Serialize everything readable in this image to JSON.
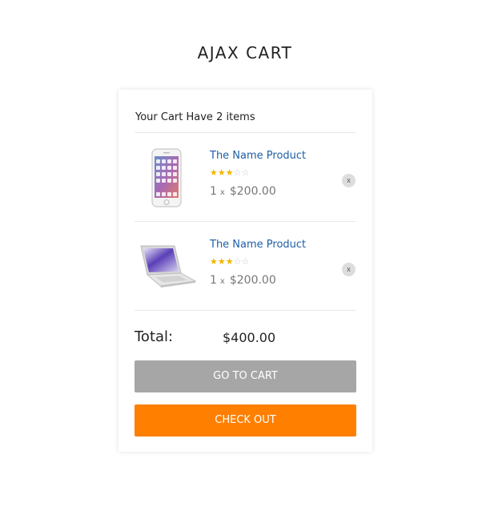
{
  "header": {
    "title": "AJAX CART"
  },
  "cart": {
    "count_text": "Your Cart Have 2 items",
    "items": [
      {
        "name": "The Name Product",
        "image_icon": "smartphone-image",
        "rating": 3,
        "rating_max": 5,
        "quantity": "1",
        "times_symbol": "x",
        "price": "$200.00",
        "remove_label": "x"
      },
      {
        "name": "The Name Product",
        "image_icon": "laptop-image",
        "rating": 3,
        "rating_max": 5,
        "quantity": "1",
        "times_symbol": "x",
        "price": "$200.00",
        "remove_label": "x"
      }
    ],
    "total_label": "Total:",
    "total_value": "$400.00",
    "go_to_cart_label": "GO TO CART",
    "checkout_label": "CHECK OUT"
  },
  "colors": {
    "link": "#1f5fa8",
    "star": "#f2b600",
    "go_to_cart_bg": "#a6a6a6",
    "checkout_bg": "#ff8000"
  }
}
